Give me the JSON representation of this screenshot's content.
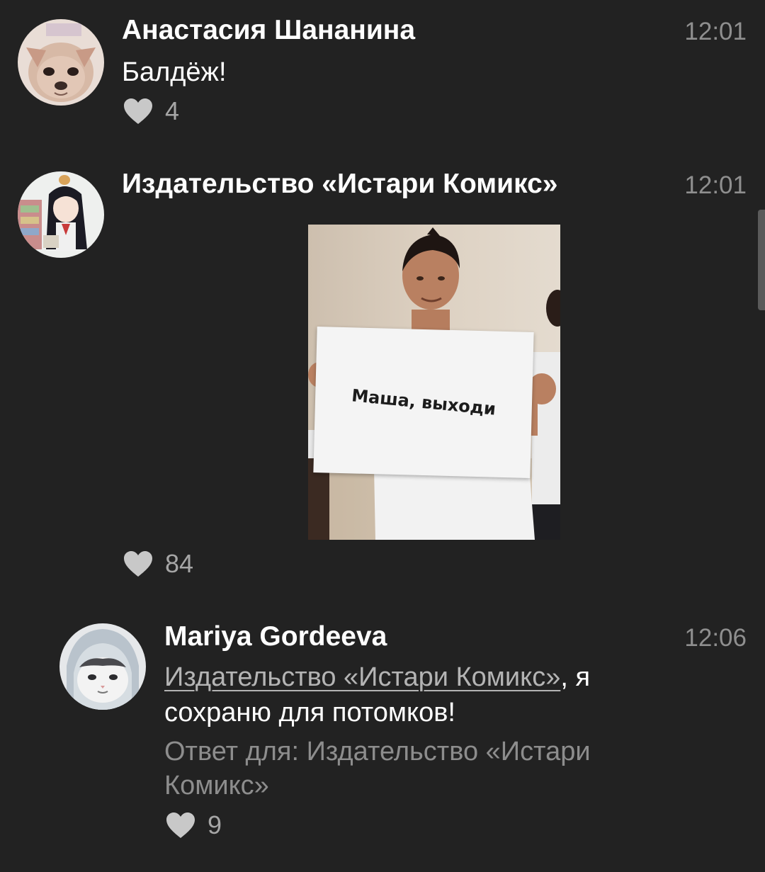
{
  "comments": [
    {
      "author": "Анастасия Шананина",
      "time": "12:01",
      "text": "Балдёж!",
      "likes": "4"
    },
    {
      "author": "Издательство «Истари Комикс»",
      "time": "12:01",
      "image_caption": "Маша, выходи",
      "likes": "84"
    },
    {
      "author": "Mariya Gordeeva",
      "time": "12:06",
      "mention": "Издательство «Истари Комикс»",
      "text_after_mention": ", я",
      "text_line2": "сохраню для потомков!",
      "reply_to_line1": "Ответ для: Издательство «Истари",
      "reply_to_line2": "Комикс»",
      "likes": "9"
    }
  ],
  "colors": {
    "background": "#222222",
    "primary_text": "#ffffff",
    "secondary_text": "#8f8f8f",
    "heart": "#c8c8c8",
    "mention": "#b4b4b4"
  },
  "icons": {
    "like": "heart-icon",
    "avatar_1": "chihuahua-avatar",
    "avatar_2": "anime-girl-avatar",
    "avatar_3": "cat-avatar"
  }
}
